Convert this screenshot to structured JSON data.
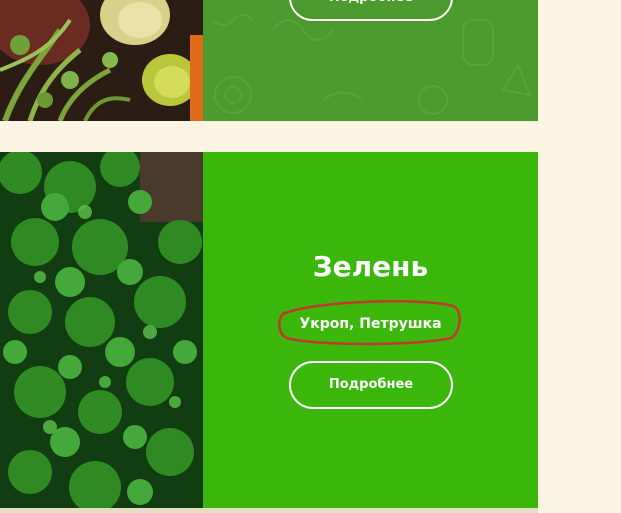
{
  "cards": [
    {
      "image_alt": "vegetables",
      "button_label": "Подробнее"
    },
    {
      "image_alt": "parsley",
      "title": "Зелень",
      "subtitle": "Укроп, Петрушка",
      "button_label": "Подробнее"
    }
  ],
  "colors": {
    "page_bg": "#fdf5e4",
    "card_green": "#3bb70b",
    "card_green_dark": "#4c9a2d",
    "annotation_red": "#c0392b"
  }
}
